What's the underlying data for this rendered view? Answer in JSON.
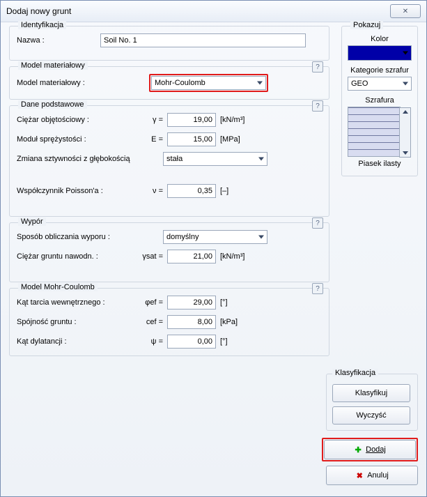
{
  "window": {
    "title": "Dodaj nowy grunt"
  },
  "identyfikacja": {
    "legend": "Identyfikacja",
    "nazwa_label": "Nazwa :",
    "nazwa_value": "Soil No. 1"
  },
  "model_mat": {
    "legend": "Model materiałowy",
    "label": "Model materiałowy :",
    "value": "Mohr-Coulomb"
  },
  "dane_podst": {
    "legend": "Dane podstawowe",
    "ciezar_label": "Ciężar objętościowy :",
    "ciezar_sym": "γ =",
    "ciezar_val": "19,00",
    "ciezar_unit": "[kN/m³]",
    "modul_label": "Moduł sprężystości :",
    "modul_sym": "E =",
    "modul_val": "15,00",
    "modul_unit": "[MPa]",
    "zmiana_label": "Zmiana sztywności z głębokością",
    "zmiana_val": "stała",
    "poisson_label": "Współczynnik Poisson'a :",
    "poisson_sym": "ν =",
    "poisson_val": "0,35",
    "poisson_unit": "[–]"
  },
  "wypor": {
    "legend": "Wypór",
    "sposob_label": "Sposób obliczania wyporu :",
    "sposob_val": "domyślny",
    "ciezar_label": "Ciężar gruntu nawodn. :",
    "ciezar_sym": "γsat =",
    "ciezar_val": "21,00",
    "ciezar_unit": "[kN/m³]"
  },
  "mohr": {
    "legend": "Model Mohr-Coulomb",
    "kat_label": "Kąt tarcia wewnętrznego :",
    "kat_sym": "φef =",
    "kat_val": "29,00",
    "kat_unit": "[°]",
    "spoj_label": "Spójność gruntu :",
    "spoj_sym": "cef =",
    "spoj_val": "8,00",
    "spoj_unit": "[kPa]",
    "dyl_label": "Kąt dylatancji :",
    "dyl_sym": "ψ =",
    "dyl_val": "0,00",
    "dyl_unit": "[°]"
  },
  "pokazuj": {
    "legend": "Pokazuj",
    "kolor_label": "Kolor",
    "kategorie_label": "Kategorie szrafur",
    "kategorie_val": "GEO",
    "szrafura_label": "Szrafura",
    "pattern_name": "Piasek ilasty"
  },
  "klasyfikacja": {
    "legend": "Klasyfikacja",
    "klasyfikuj": "Klasyfikuj",
    "wyczysc": "Wyczyść"
  },
  "buttons": {
    "dodaj": "Dodaj",
    "anuluj": "Anuluj"
  }
}
